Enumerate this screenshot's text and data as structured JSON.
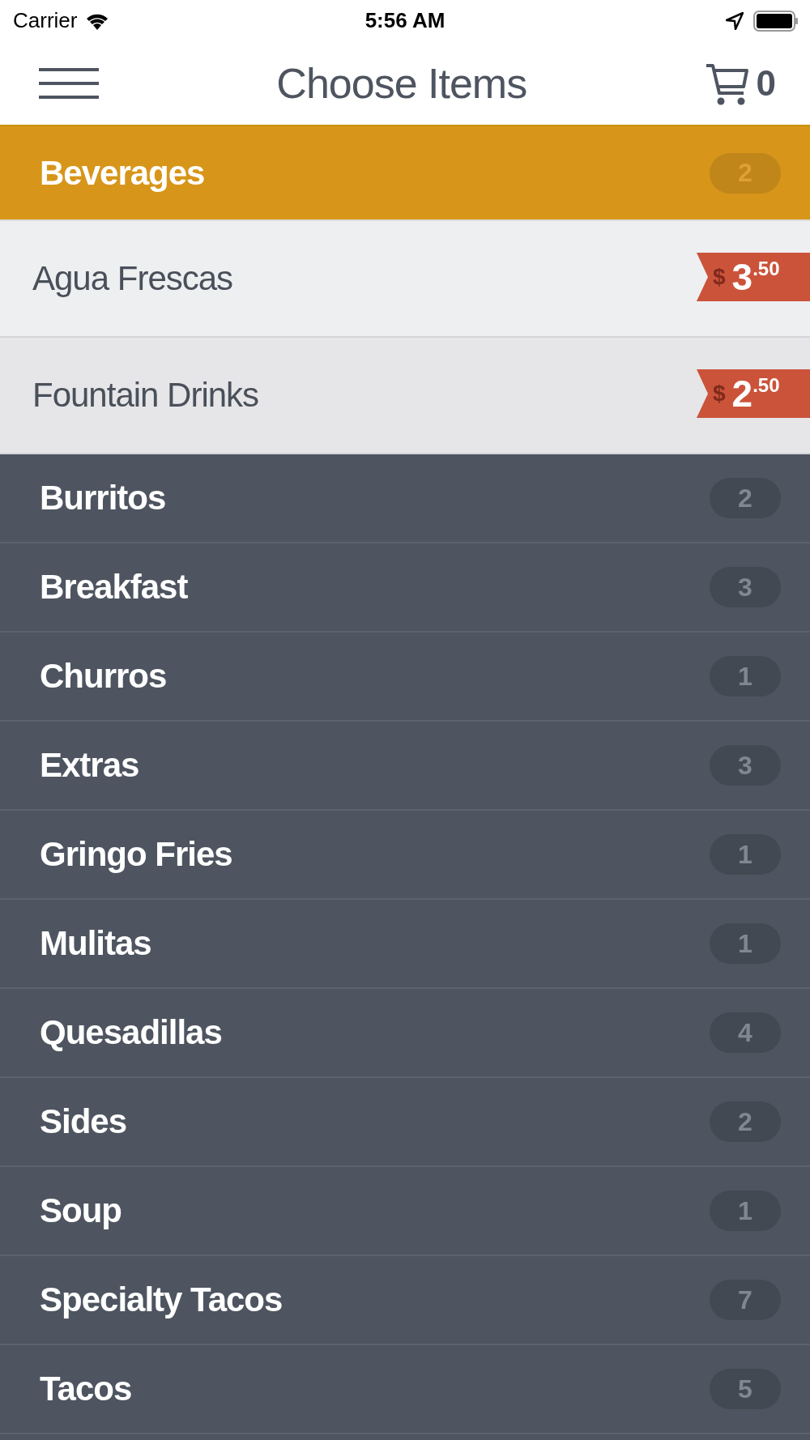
{
  "status_bar": {
    "carrier": "Carrier",
    "time": "5:56 AM"
  },
  "nav": {
    "title": "Choose Items",
    "cart_count": "0"
  },
  "categories": [
    {
      "name": "Beverages",
      "count": "2",
      "expanded": true,
      "items": [
        {
          "name": "Agua Frescas",
          "currency": "$",
          "whole": "3",
          "cents": ".50"
        },
        {
          "name": "Fountain Drinks",
          "currency": "$",
          "whole": "2",
          "cents": ".50"
        }
      ]
    },
    {
      "name": "Burritos",
      "count": "2",
      "expanded": false
    },
    {
      "name": "Breakfast",
      "count": "3",
      "expanded": false
    },
    {
      "name": "Churros",
      "count": "1",
      "expanded": false
    },
    {
      "name": "Extras",
      "count": "3",
      "expanded": false
    },
    {
      "name": "Gringo Fries",
      "count": "1",
      "expanded": false
    },
    {
      "name": "Mulitas",
      "count": "1",
      "expanded": false
    },
    {
      "name": "Quesadillas",
      "count": "4",
      "expanded": false
    },
    {
      "name": "Sides",
      "count": "2",
      "expanded": false
    },
    {
      "name": "Soup",
      "count": "1",
      "expanded": false
    },
    {
      "name": "Specialty Tacos",
      "count": "7",
      "expanded": false
    },
    {
      "name": "Tacos",
      "count": "5",
      "expanded": false
    }
  ]
}
